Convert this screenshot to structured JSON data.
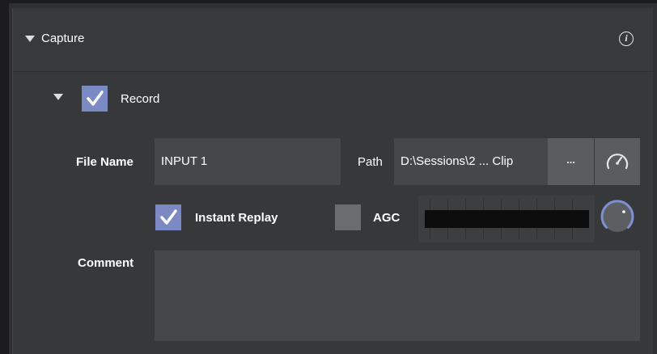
{
  "section": {
    "title": "Capture",
    "info_icon": "info-icon"
  },
  "record": {
    "label": "Record",
    "checked": true
  },
  "file_name": {
    "label": "File Name",
    "value": "INPUT 1"
  },
  "path": {
    "label": "Path",
    "value": "D:\\Sessions\\2 ... Clip",
    "browse_label": "...",
    "meter_icon": "gauge-icon"
  },
  "instant_replay": {
    "label": "Instant Replay",
    "checked": true
  },
  "agc": {
    "label": "AGC",
    "checked": false
  },
  "comment": {
    "label": "Comment",
    "value": ""
  },
  "colors": {
    "accent": "#7b8ac5",
    "panel": "#36383a",
    "field": "#45484a"
  }
}
